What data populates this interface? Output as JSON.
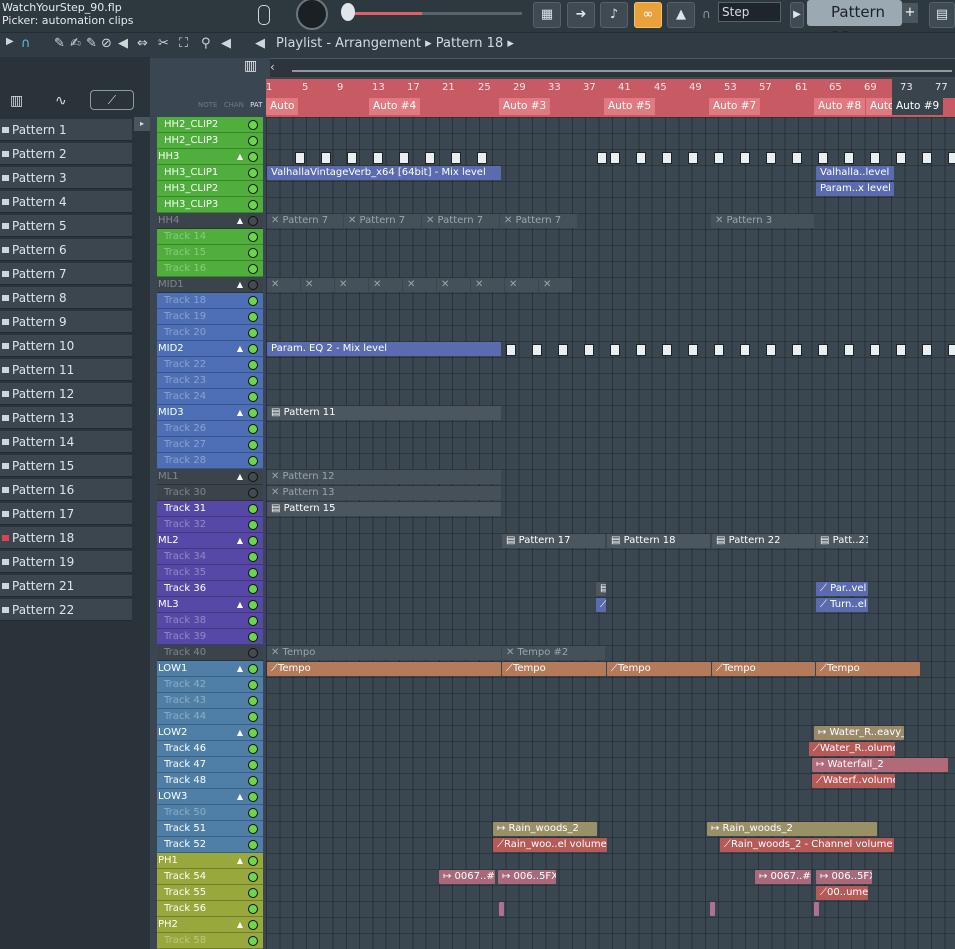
{
  "window": {
    "file": "WatchYourStep_90.flp",
    "hint": "Picker: automation clips"
  },
  "toolbar": {
    "snap": "Step",
    "pattern": "Pattern 18",
    "add_label": "+"
  },
  "breadcrumb": [
    "Playlist - Arrangement",
    "Pattern 18"
  ],
  "ruler": {
    "numbers": [
      "1",
      "5",
      "9",
      "13",
      "17",
      "21",
      "25",
      "29",
      "33",
      "37",
      "41",
      "45",
      "49",
      "53",
      "57",
      "61",
      "65",
      "69",
      "73",
      "77"
    ],
    "markers": [
      "Auto",
      "Auto #4",
      "Auto #3",
      "Auto #5",
      "Auto #7",
      "Auto #8",
      "Auto",
      "Auto #9"
    ]
  },
  "picker_header": [
    "NOTE",
    "CHAN",
    "PAT"
  ],
  "patterns": [
    "Pattern 1",
    "Pattern 2",
    "Pattern 3",
    "Pattern 4",
    "Pattern 5",
    "Pattern 6",
    "Pattern 7",
    "Pattern 8",
    "Pattern 9",
    "Pattern 10",
    "Pattern 11",
    "Pattern 12",
    "Pattern 13",
    "Pattern 14",
    "Pattern 15",
    "Pattern 16",
    "Pattern 17",
    "Pattern 18",
    "Pattern 19",
    "Pattern 21",
    "Pattern 22"
  ],
  "tracks": [
    "HH2_CLIP2",
    "HH2_CLIP3",
    "HH3",
    "HH3_CLIP1",
    "HH3_CLIP2",
    "HH3_CLIP3",
    "HH4",
    "Track 14",
    "Track 15",
    "Track 16",
    "MID1",
    "Track 18",
    "Track 19",
    "Track 20",
    "MID2",
    "Track 22",
    "Track 23",
    "Track 24",
    "MID3",
    "Track 26",
    "Track 27",
    "Track 28",
    "ML1",
    "Track 30",
    "Track 31",
    "Track 32",
    "ML2",
    "Track 34",
    "Track 35",
    "Track 36",
    "ML3",
    "Track 38",
    "Track 39",
    "Track 40",
    "LOW1",
    "Track 42",
    "Track 43",
    "Track 44",
    "LOW2",
    "Track 46",
    "Track 47",
    "Track 48",
    "LOW3",
    "Track 50",
    "Track 51",
    "Track 52",
    "PH1",
    "Track 54",
    "Track 55",
    "Track 56",
    "PH2",
    "Track 58"
  ],
  "clips": {
    "valhalla": "ValhallaVintageVerb_x64 [64bit] - Mix level",
    "valhalla2": "Valhalla..level",
    "param1": "Param..x level",
    "p7a": "Pattern 7",
    "p7b": "Pattern 7",
    "p7c": "Pattern 7",
    "p7d": "Pattern 7",
    "p3": "Pattern 3",
    "eq": "Param. EQ 2 - Mix level",
    "p11": "Pattern 11",
    "p12": "Pattern 12",
    "p13": "Pattern 13",
    "p15": "Pattern 15",
    "p17": "Pattern 17",
    "p18": "Pattern 18",
    "p22": "Pattern 22",
    "p21": "Patt..21",
    "parvel": "Par..vel",
    "turnel": "Turn..el",
    "tempo_a": "Tempo",
    "tempo_b": "Tempo #2",
    "t1": "Tempo",
    "t2": "Tempo",
    "t3": "Tempo",
    "t4": "Tempo",
    "t5": "Tempo",
    "water1": "Water_R..eavy_1",
    "water2": "Water_R..olume",
    "water3": "Waterfall_2",
    "water4": "Waterf..volume",
    "rain1": "Rain_woods_2",
    "rain2": "Rain_woo..el volume",
    "rain3": "Rain_woods_2",
    "rain4": "Rain_woods_2 - Channel volume #2",
    "s1": "0067..#2",
    "s2": "006..5FX",
    "s3": "0067..#2",
    "s4": "006..5FX",
    "s5": "00..ume"
  }
}
